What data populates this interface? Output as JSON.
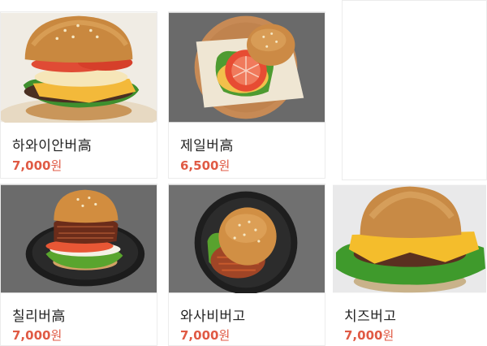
{
  "products": [
    {
      "name": "하와이안버高",
      "price": "7,000",
      "currency": "원",
      "image_icon": "hawaiian-burger-photo-icon"
    },
    {
      "name": "제일버高",
      "price": "6,500",
      "currency": "원",
      "image_icon": "jeil-burger-photo-icon"
    },
    {
      "name": "칠리버高",
      "price": "7,000",
      "currency": "원",
      "image_icon": "chili-burger-photo-icon"
    },
    {
      "name": "와사비버고",
      "price": "7,000",
      "currency": "원",
      "image_icon": "wasabi-burger-photo-icon"
    },
    {
      "name": "치즈버고",
      "price": "7,000",
      "currency": "원",
      "image_icon": "cheese-burger-photo-icon"
    }
  ],
  "colors": {
    "price": "#e05a44",
    "text": "#222222",
    "background": "#ffffff"
  }
}
